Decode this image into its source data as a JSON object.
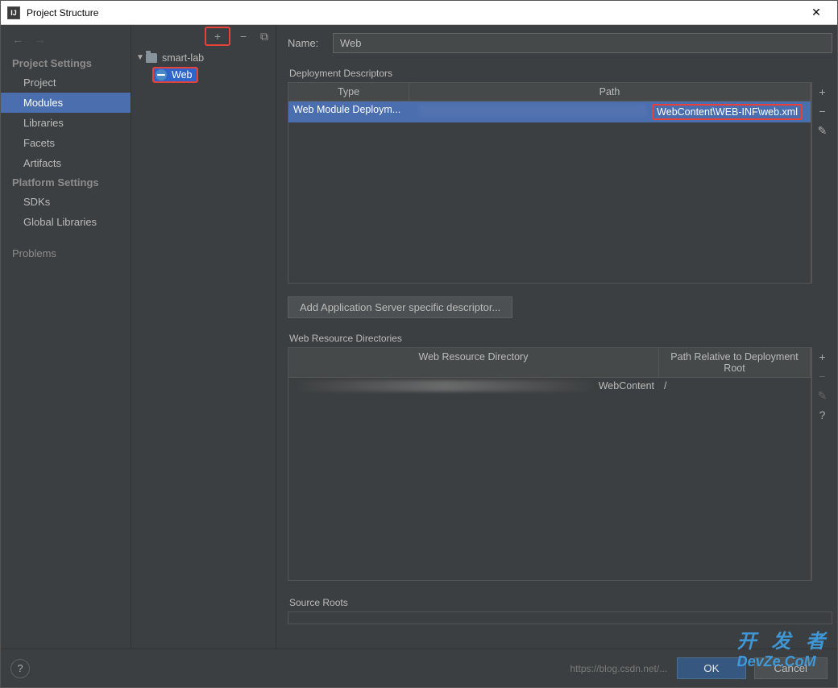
{
  "window": {
    "title": "Project Structure",
    "close": "✕"
  },
  "sidebar": {
    "nav": {
      "back": "←",
      "forward": "→"
    },
    "sections": [
      {
        "title": "Project Settings",
        "items": [
          "Project",
          "Modules",
          "Libraries",
          "Facets",
          "Artifacts"
        ],
        "selected": "Modules"
      },
      {
        "title": "Platform Settings",
        "items": [
          "SDKs",
          "Global Libraries"
        ]
      }
    ],
    "problems": "Problems"
  },
  "tree_toolbar": {
    "add": "+",
    "remove": "−",
    "copy": "⧉"
  },
  "tree": {
    "root": "smart-lab",
    "child": "Web"
  },
  "name": {
    "label": "Name:",
    "value": "Web"
  },
  "deployment_descriptors": {
    "title": "Deployment Descriptors",
    "columns": {
      "type": "Type",
      "path": "Path"
    },
    "row": {
      "type": "Web Module Deploym...",
      "path_suffix": "WebContent\\WEB-INF\\web.xml"
    },
    "add_button": "Add Application Server specific descriptor..."
  },
  "web_resources": {
    "title": "Web Resource Directories",
    "columns": {
      "dir": "Web Resource Directory",
      "rel": "Path Relative to Deployment Root"
    },
    "row": {
      "dir_suffix": "WebContent",
      "rel": "/"
    }
  },
  "source_roots": {
    "title": "Source Roots"
  },
  "side_tools": {
    "add": "+",
    "remove": "−",
    "edit": "✎",
    "help": "?"
  },
  "footer": {
    "help": "?",
    "watermark": "https://blog.csdn.net/...",
    "ok": "OK",
    "cancel": "Cancel"
  },
  "logo_wm": "开 发 者\nDevZe.CoM"
}
